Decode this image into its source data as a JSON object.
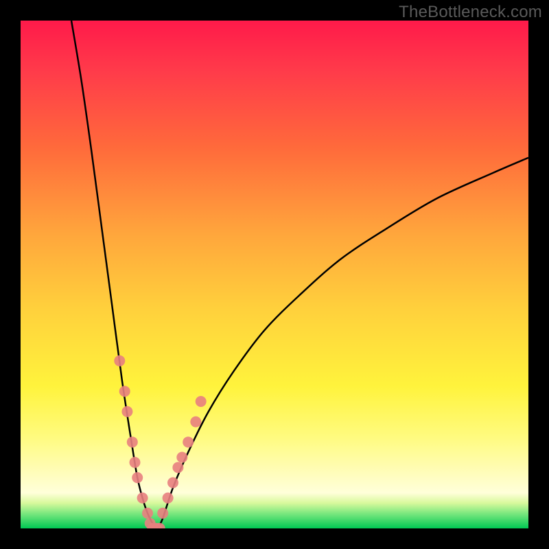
{
  "watermark": "TheBottleneck.com",
  "colors": {
    "frame": "#000000",
    "gradient_top": "#ff1a4a",
    "gradient_bottom": "#00c853",
    "curve": "#000000",
    "marker": "#e88080"
  },
  "chart_data": {
    "type": "line",
    "title": "",
    "xlabel": "",
    "ylabel": "",
    "xlim": [
      0,
      100
    ],
    "ylim": [
      0,
      100
    ],
    "grid": false,
    "legend": false,
    "series": [
      {
        "name": "left-branch",
        "style": "line",
        "x": [
          10,
          12,
          14,
          16,
          18,
          20,
          22,
          23,
          24,
          25,
          26,
          27
        ],
        "y": [
          100,
          88,
          74,
          59,
          44,
          29,
          16,
          10,
          6,
          3,
          1,
          0
        ]
      },
      {
        "name": "right-branch",
        "style": "line",
        "x": [
          27,
          28,
          30,
          33,
          37,
          42,
          48,
          55,
          63,
          72,
          82,
          93,
          100
        ],
        "y": [
          0,
          2,
          8,
          15,
          23,
          31,
          39,
          46,
          53,
          59,
          65,
          70,
          73
        ]
      },
      {
        "name": "left-markers",
        "style": "scatter",
        "x": [
          19.5,
          20.5,
          21.0,
          22.0,
          22.5,
          23.0,
          24.0,
          25.0,
          25.5
        ],
        "y": [
          33,
          27,
          23,
          17,
          13,
          10,
          6,
          3,
          1
        ]
      },
      {
        "name": "right-markers",
        "style": "scatter",
        "x": [
          28.0,
          29.0,
          30.0,
          31.0,
          31.8,
          33.0,
          34.5,
          35.5
        ],
        "y": [
          3,
          6,
          9,
          12,
          14,
          17,
          21,
          25
        ]
      },
      {
        "name": "valley-markers",
        "style": "scatter",
        "x": [
          26.0,
          26.8,
          27.4
        ],
        "y": [
          0,
          0,
          0
        ]
      }
    ]
  }
}
